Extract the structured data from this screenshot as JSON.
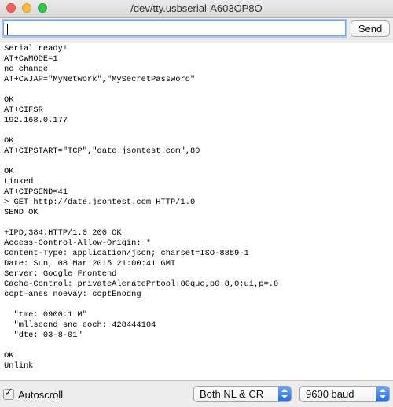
{
  "window": {
    "title": "/dev/tty.usbserial-A603OP8O"
  },
  "input": {
    "value": "",
    "send_label": "Send"
  },
  "output": {
    "lines": [
      "Serial ready!",
      "AT+CWMODE=1",
      "no change",
      "AT+CWJAP=\"MyNetwork\",\"MySecretPassword\"",
      "",
      "OK",
      "AT+CIFSR",
      "192.168.0.177",
      "",
      "OK",
      "AT+CIPSTART=\"TCP\",\"date.jsontest.com\",80",
      "",
      "OK",
      "Linked",
      "AT+CIPSEND=41",
      "> GET http://date.jsontest.com HTTP/1.0",
      "SEND OK",
      "",
      "+IPD,384:HTTP/1.0 200 OK",
      "Access-Control-Allow-Origin: *",
      "Content-Type: application/json; charset=ISO-8859-1",
      "Date: Sun, 08 Mar 2015 21:00:41 GMT",
      "Server: Google Frontend",
      "Cache-Control: privateAleratePrtool:80quc,p0.8,0:ui,p=.0",
      "ccpt-anes noeVay: ccptEnodng",
      "",
      "  \"tme: 0900:1 M\"",
      "  \"mllsecnd_snc_eoch: 428444104",
      "  \"dte: 03-8-01\"",
      "",
      "OK",
      "Unlink"
    ]
  },
  "footer": {
    "autoscroll_label": "Autoscroll",
    "autoscroll_checked": true,
    "line_ending": "Both NL & CR",
    "baud_rate": "9600 baud"
  },
  "colors": {
    "close": "#fc605c",
    "minimize": "#fdbc40",
    "maximize": "#34c84a",
    "select_accent": "#1f6fe8"
  }
}
